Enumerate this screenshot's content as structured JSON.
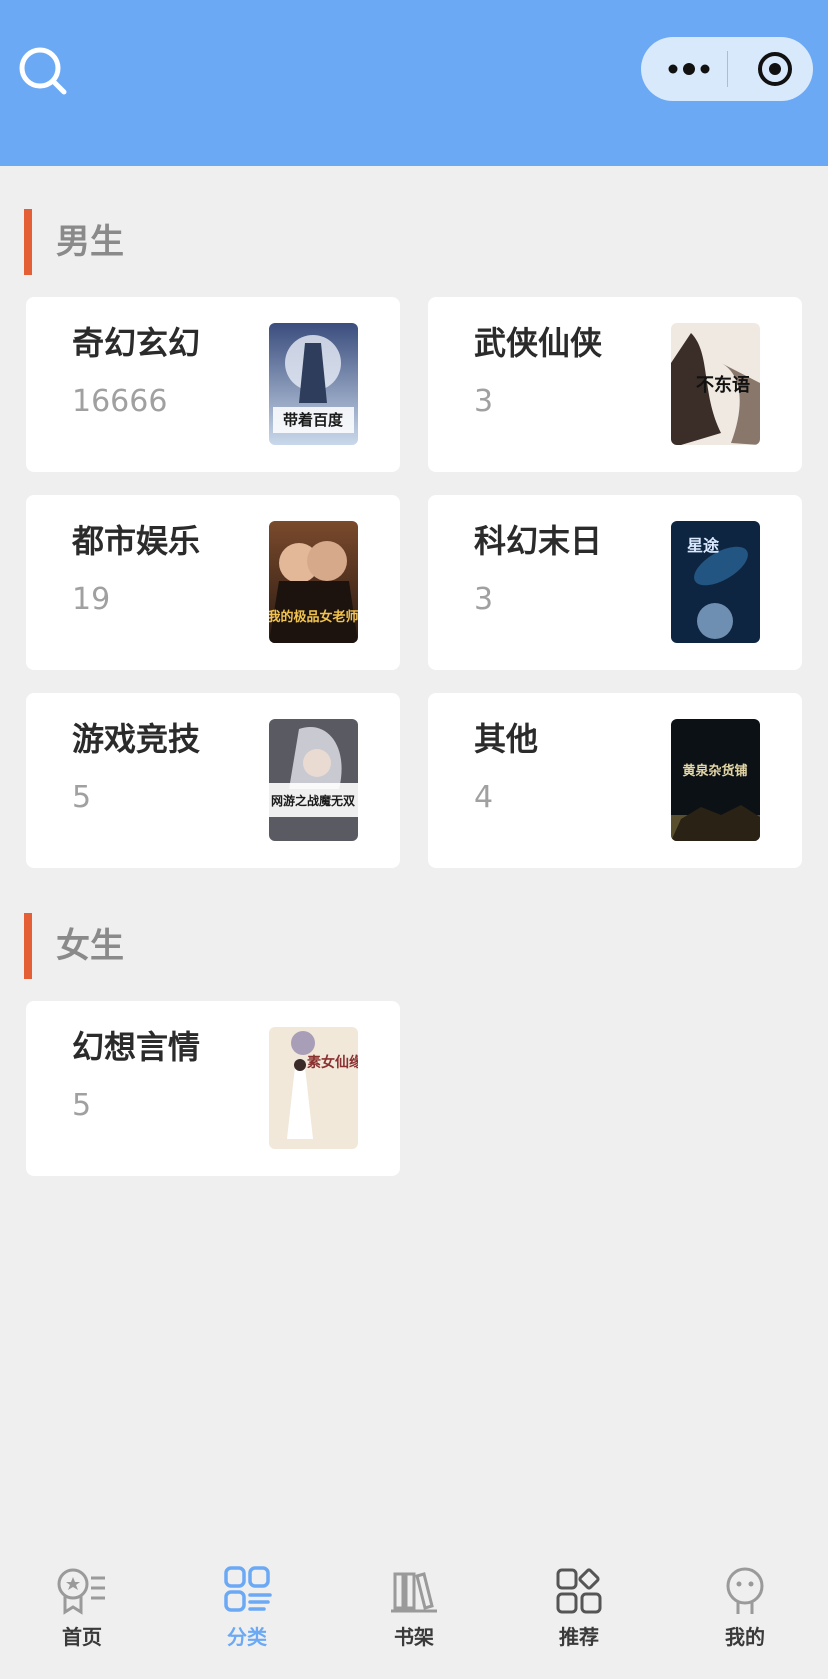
{
  "header": {
    "search_icon": "search-icon",
    "capsule": {
      "more_icon": "more-dots-icon",
      "close_icon": "target-close-icon"
    },
    "color": "#6ba9f5"
  },
  "sections": [
    {
      "title": "男生",
      "items": [
        {
          "name": "奇幻玄幻",
          "count": "16666",
          "cover_text": "带着百度"
        },
        {
          "name": "武侠仙侠",
          "count": "3",
          "cover_text": "不东语"
        },
        {
          "name": "都市娱乐",
          "count": "19",
          "cover_text": "我的极品女老师"
        },
        {
          "name": "科幻末日",
          "count": "3",
          "cover_text": "星途"
        },
        {
          "name": "游戏竞技",
          "count": "5",
          "cover_text": "网游之战魔无双"
        },
        {
          "name": "其他",
          "count": "4",
          "cover_text": "黄泉杂货铺"
        }
      ]
    },
    {
      "title": "女生",
      "items": [
        {
          "name": "幻想言情",
          "count": "5",
          "cover_text": "素女仙缘"
        }
      ]
    }
  ],
  "tabbar": {
    "tabs": [
      {
        "label": "首页",
        "icon": "home-badge-icon",
        "active": false
      },
      {
        "label": "分类",
        "icon": "category-grid-icon",
        "active": true
      },
      {
        "label": "书架",
        "icon": "bookshelf-icon",
        "active": false
      },
      {
        "label": "推荐",
        "icon": "recommend-apps-icon",
        "active": false
      },
      {
        "label": "我的",
        "icon": "profile-face-icon",
        "active": false
      }
    ],
    "active_color": "#6ba9f5"
  },
  "accent_color": "#e45f35"
}
